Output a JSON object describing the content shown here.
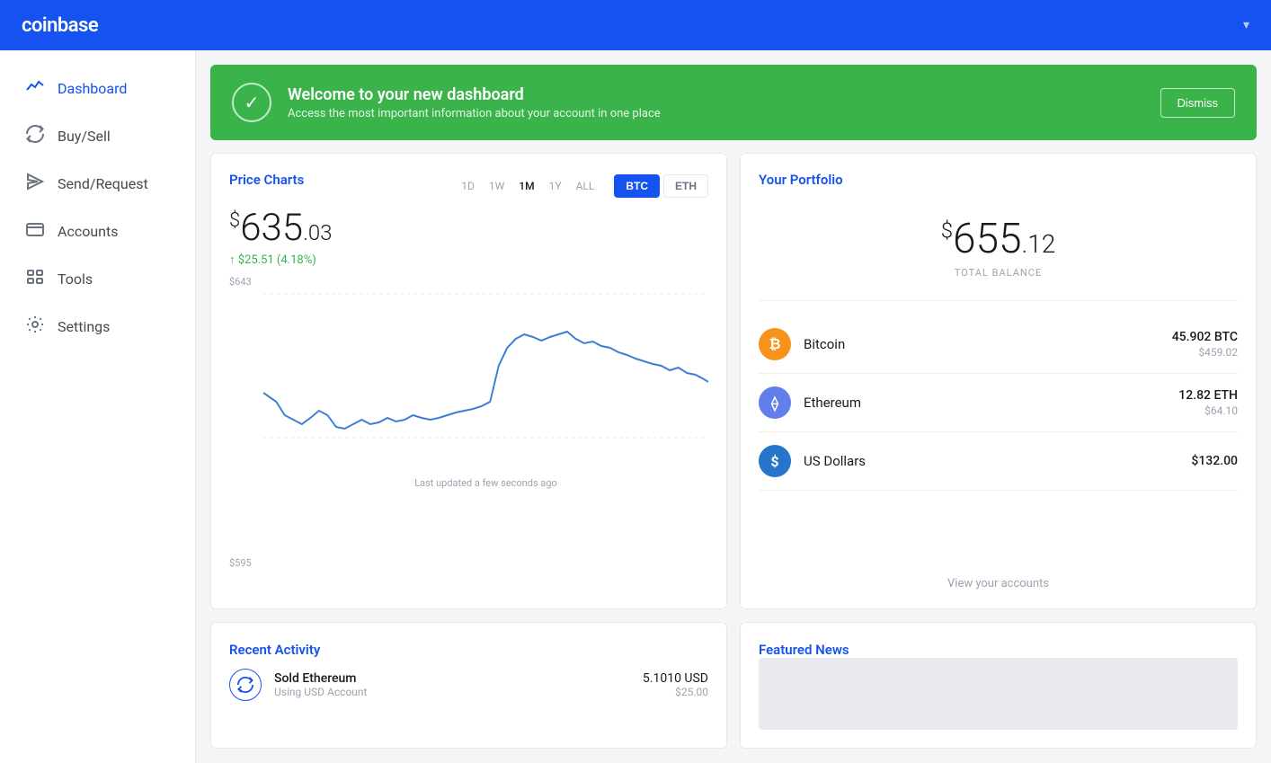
{
  "header": {
    "logo": "coinbase",
    "chevron": "▾"
  },
  "sidebar": {
    "items": [
      {
        "id": "dashboard",
        "label": "Dashboard",
        "icon": "activity",
        "active": true
      },
      {
        "id": "buysell",
        "label": "Buy/Sell",
        "icon": "refresh",
        "active": false
      },
      {
        "id": "sendrequest",
        "label": "Send/Request",
        "icon": "send",
        "active": false
      },
      {
        "id": "accounts",
        "label": "Accounts",
        "icon": "card",
        "active": false
      },
      {
        "id": "tools",
        "label": "Tools",
        "icon": "tools",
        "active": false
      },
      {
        "id": "settings",
        "label": "Settings",
        "icon": "gear",
        "active": false
      }
    ]
  },
  "banner": {
    "title": "Welcome to your new dashboard",
    "subtitle": "Access the most important information about your account in one place",
    "dismiss_label": "Dismiss"
  },
  "price_chart": {
    "section_title": "Price Charts",
    "price": "$635",
    "price_cents": ".03",
    "price_symbol": "$",
    "price_whole": "635",
    "change": "↑ $25.51 (4.18%)",
    "time_filters": [
      "1D",
      "1W",
      "1M",
      "1Y",
      "ALL"
    ],
    "active_filter": "1M",
    "crypto_buttons": [
      "BTC",
      "ETH"
    ],
    "active_crypto": "BTC",
    "chart_high_label": "$643",
    "chart_low_label": "$595",
    "updated_text": "Last updated a few seconds ago"
  },
  "portfolio": {
    "section_title": "Your Portfolio",
    "total_balance": "$655.12",
    "total_balance_symbol": "$",
    "total_balance_whole": "655",
    "total_balance_cents": ".12",
    "total_label": "TOTAL BALANCE",
    "assets": [
      {
        "id": "btc",
        "name": "Bitcoin",
        "crypto_amount": "45.902 BTC",
        "usd_amount": "$459.02",
        "icon_type": "btc",
        "icon_text": "₿"
      },
      {
        "id": "eth",
        "name": "Ethereum",
        "crypto_amount": "12.82 ETH",
        "usd_amount": "$64.10",
        "icon_type": "eth",
        "icon_text": "⟠"
      },
      {
        "id": "usd",
        "name": "US Dollars",
        "crypto_amount": "$132.00",
        "usd_amount": "",
        "icon_type": "usd",
        "icon_text": "$"
      }
    ],
    "view_accounts_label": "View your accounts"
  },
  "recent_activity": {
    "section_title": "Recent Activity",
    "items": [
      {
        "type": "sold",
        "title": "Sold Ethereum",
        "subtitle": "Using USD Account",
        "crypto_val": "5.1010 USD",
        "usd_val": "$25.00"
      }
    ]
  },
  "featured_news": {
    "section_title": "Featured News"
  }
}
